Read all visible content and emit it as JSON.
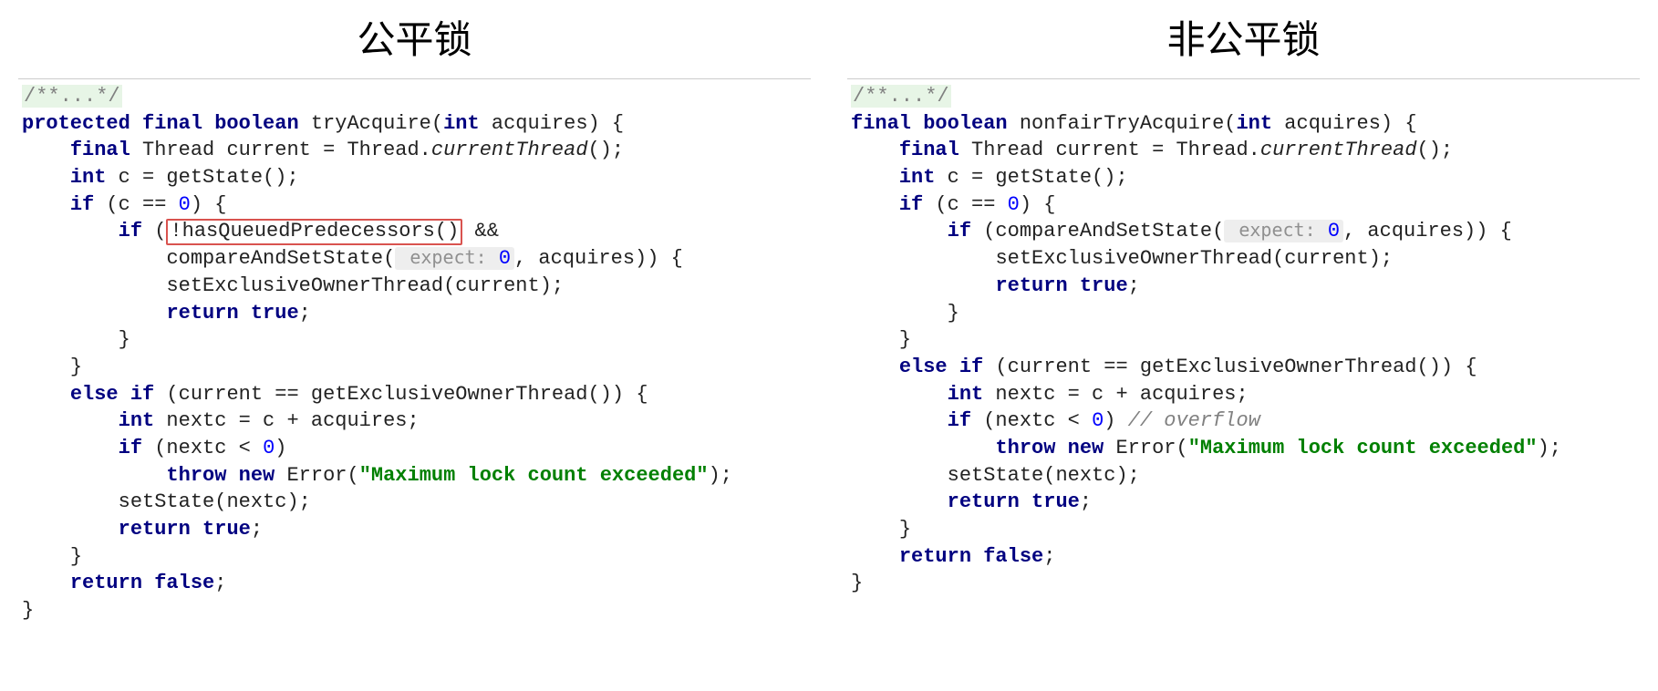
{
  "left": {
    "title": "公平锁",
    "doc_comment": "/**...*/",
    "sig_modifiers": "protected final boolean",
    "sig_name": "tryAcquire(",
    "sig_param_type": "int",
    "sig_param_name": " acquires) {",
    "l_final": "final",
    "l_thread_decl": " Thread current = Thread.",
    "l_currentThread": "currentThread",
    "l_after_currentThread": "();",
    "l_int": "int",
    "l_getstate": " c = getState();",
    "l_if_open": "if",
    "l_if_cond_open": " (c == ",
    "l_zero": "0",
    "l_if_cond_close": ") {",
    "l_if2": "if",
    "l_if2_open": " (",
    "l_hasQueued": "!hasQueuedPredecessors()",
    "l_and": " &&",
    "l_cas": "compareAndSetState(",
    "l_hint_expect": " expect:",
    "l_cas_zero": "0",
    "l_cas_close": ", acquires)) {",
    "l_setOwner": "setExclusiveOwnerThread(current);",
    "l_return": "return",
    "l_true": "true",
    "l_semi": ";",
    "l_brace_close": "}",
    "l_else_if": "else if",
    "l_else_if_cond": " (current == getExclusiveOwnerThread()) {",
    "l_int2": "int",
    "l_nextc": " nextc = c + acquires;",
    "l_if3": "if",
    "l_if3_open": " (nextc < ",
    "l_zero2": "0",
    "l_if3_close": ")",
    "l_throw": "throw",
    "l_new": "new",
    "l_error": " Error(",
    "l_error_msg": "\"Maximum lock count exceeded\"",
    "l_error_close": ");",
    "l_setstate": "setState(nextc);",
    "l_return2": "return",
    "l_true2": "true",
    "l_return3": "return",
    "l_false": "false"
  },
  "right": {
    "title": "非公平锁",
    "doc_comment": "/**...*/",
    "sig_modifiers": "final boolean",
    "sig_name": "nonfairTryAcquire(",
    "sig_param_type": "int",
    "sig_param_name": " acquires) {",
    "r_final": "final",
    "r_thread_decl": " Thread current = Thread.",
    "r_currentThread": "currentThread",
    "r_after_currentThread": "();",
    "r_int": "int",
    "r_getstate": " c = getState();",
    "r_if_open": "if",
    "r_if_cond_open": " (c == ",
    "r_zero": "0",
    "r_if_cond_close": ") {",
    "r_if2": "if",
    "r_if2_open": " (compareAndSetState(",
    "r_hint_expect": " expect:",
    "r_cas_zero": "0",
    "r_cas_close": ", acquires)) {",
    "r_setOwner": "setExclusiveOwnerThread(current);",
    "r_return": "return",
    "r_true": "true",
    "r_semi": ";",
    "r_brace_close": "}",
    "r_else_if": "else if",
    "r_else_if_cond": " (current == getExclusiveOwnerThread()) {",
    "r_int2": "int",
    "r_nextc": " nextc = c + acquires;",
    "r_if3": "if",
    "r_if3_open": " (nextc < ",
    "r_zero2": "0",
    "r_if3_close": ") ",
    "r_overflow": "// overflow",
    "r_throw": "throw",
    "r_new": "new",
    "r_error": " Error(",
    "r_error_msg": "\"Maximum lock count exceeded\"",
    "r_error_close": ");",
    "r_setstate": "setState(nextc);",
    "r_return2": "return",
    "r_true2": "true",
    "r_return3": "return",
    "r_false": "false"
  }
}
